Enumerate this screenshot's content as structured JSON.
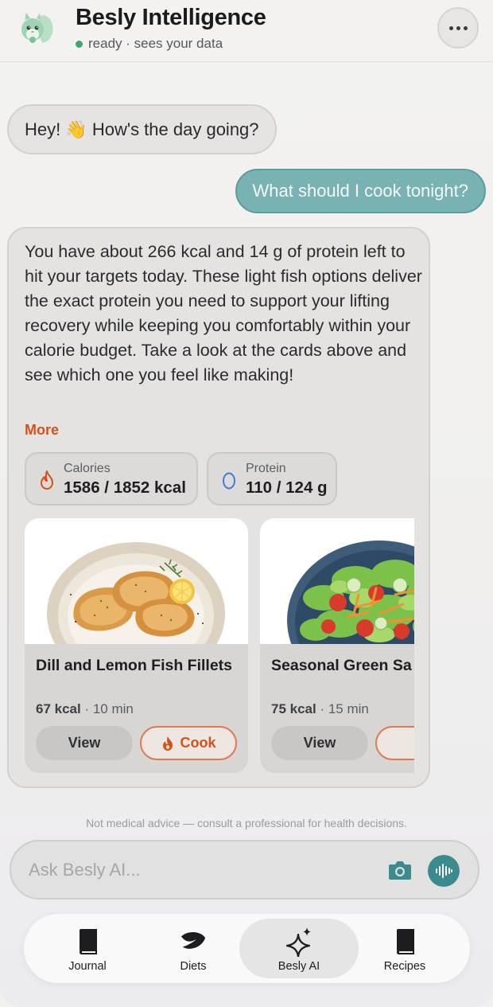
{
  "header": {
    "title": "Besly Intelligence",
    "status": "ready · sees your data"
  },
  "messages": {
    "greeting": "Hey! 👋 How's the day going?",
    "user_question": "What should I cook tonight?",
    "ai_reply": "You have about 266 kcal and 14 g of protein left to hit your targets today. These light fish options deliver the exact protein you need to support your lifting recovery while keeping you comfortably within your calorie budget. Take a look at the cards above and see which one you feel like making!",
    "more_label": "More"
  },
  "stats": {
    "calories": {
      "label": "Calories",
      "value": "1586 / 1852 kcal",
      "progress": 0.856
    },
    "protein": {
      "label": "Protein",
      "value": "110 / 124 g",
      "progress": 0.887
    }
  },
  "recipes": [
    {
      "name": "Dill and Lemon Fish Fillets",
      "kcal": "67 kcal",
      "time": "· 10 min",
      "view_label": "View",
      "cook_label": "Cook"
    },
    {
      "name": "Seasonal Green Sa",
      "kcal": "75 kcal",
      "time": "· 15 min",
      "view_label": "View",
      "cook_label": ""
    }
  ],
  "disclaimer": "Not medical advice — consult a professional for health decisions.",
  "input": {
    "placeholder": "Ask Besly AI..."
  },
  "tabs": [
    {
      "label": "Journal",
      "icon": "book-icon"
    },
    {
      "label": "Diets",
      "icon": "leaf-icon"
    },
    {
      "label": "Besly AI",
      "icon": "sparkles-icon",
      "active": true
    },
    {
      "label": "Recipes",
      "icon": "book-icon"
    }
  ],
  "colors": {
    "accent_orange": "#d3521c",
    "teal": "#3b8b8e",
    "user_bubble": "#78b2b2",
    "status_green": "#3ea86a"
  }
}
